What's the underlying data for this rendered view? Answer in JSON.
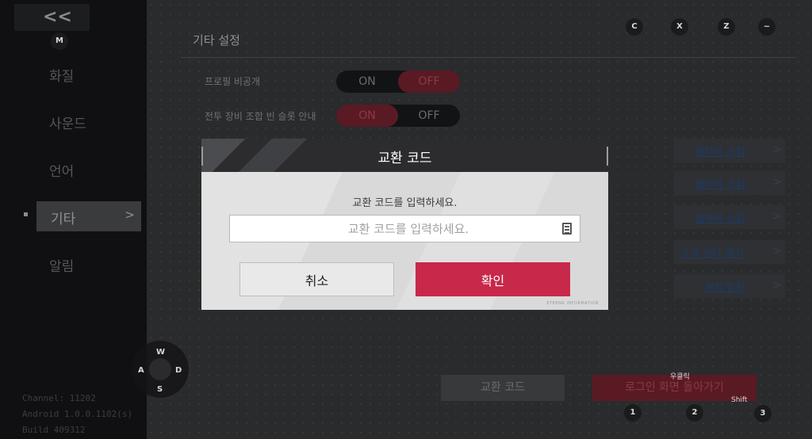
{
  "sidebar": {
    "back_label": "<<",
    "shortcut_key": "M",
    "items": [
      {
        "label": "화질"
      },
      {
        "label": "사운드"
      },
      {
        "label": "언어"
      },
      {
        "label": "기타"
      },
      {
        "label": "알림"
      }
    ],
    "active_chevron": ">",
    "build_info": [
      "Channel: 11202",
      "Android 1.0.0.1102(s)",
      "Build 409312"
    ]
  },
  "page": {
    "title": "기타 설정",
    "rows": [
      {
        "label": "프로필 비공개",
        "on": "ON",
        "off": "OFF",
        "selected": "OFF"
      },
      {
        "label": "전투 장비 조합 빈 슬롯 안내",
        "on": "ON",
        "off": "OFF",
        "selected": "ON"
      }
    ],
    "links": [
      "웹하여 스킵",
      "웹하여 스킵",
      "웹하여 스킵",
      "고객 센터 열기",
      "계정 탈퇴"
    ],
    "link_arrow": ">"
  },
  "bottom": {
    "exchange_button": "교환 코드",
    "logout_button": "로그인 화면 돌아가기"
  },
  "key_hints": {
    "top": [
      "C",
      "X",
      "Z",
      "~"
    ],
    "bottom": [
      "1",
      "2",
      "3"
    ],
    "right_click_label": "우클릭",
    "shift_label": "Shift"
  },
  "joystick": {
    "up": "W",
    "left": "A",
    "right": "D",
    "down": "S"
  },
  "dialog": {
    "title": "교환 코드",
    "prompt": "교환 코드를 입력하세요.",
    "input_placeholder": "교환 코드를 입력하세요.",
    "input_value": "",
    "cancel_label": "취소",
    "confirm_label": "확인",
    "watermark": "ETERNA INFORMATION"
  },
  "colors": {
    "accent": "#c8284a",
    "dialog_body": "#d9d9d9",
    "dialog_header": "#2c2c2e"
  }
}
